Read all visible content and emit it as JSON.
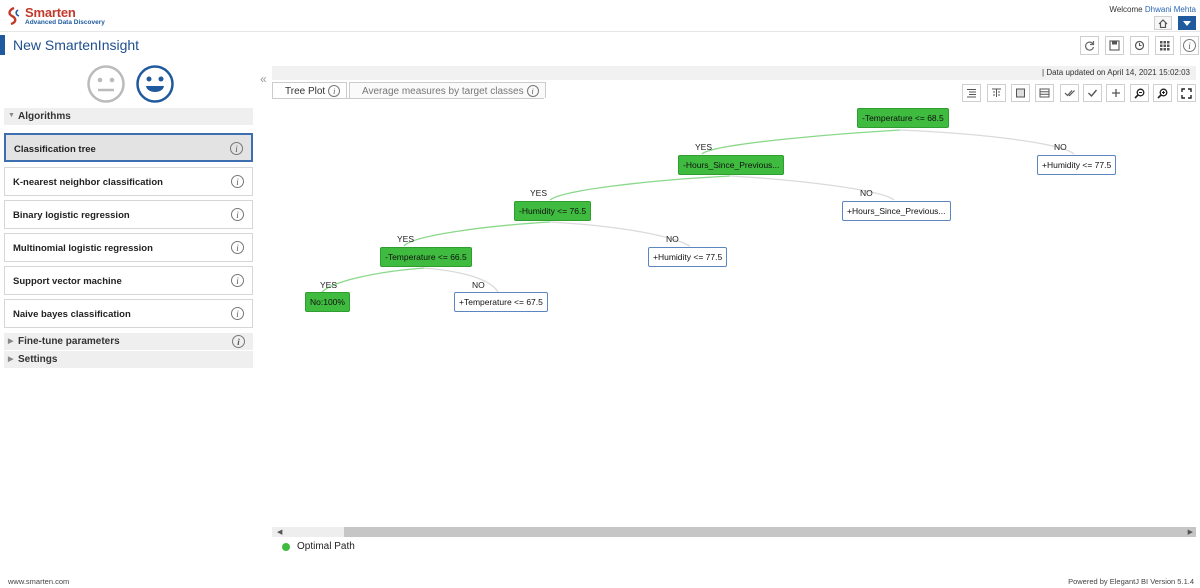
{
  "brand": {
    "logo_line1": "Smarten",
    "logo_line2": "Advanced Data Discovery"
  },
  "header": {
    "welcome": "Welcome",
    "user": "Dhwani Mehta"
  },
  "page_title": "New SmartenInsight",
  "algorithms_label": "Algorithms",
  "algorithms": [
    {
      "label": "Classification tree",
      "selected": true
    },
    {
      "label": "K-nearest neighbor classification",
      "selected": false
    },
    {
      "label": "Binary logistic regression",
      "selected": false
    },
    {
      "label": "Multinomial logistic regression",
      "selected": false
    },
    {
      "label": "Support vector machine",
      "selected": false
    },
    {
      "label": "Naive bayes classification",
      "selected": false
    }
  ],
  "fine_tune_label": "Fine-tune parameters",
  "settings_label": "Settings",
  "data_updated": "|  Data updated on April 14, 2021 15:02:03",
  "tabs": [
    {
      "label": "Tree Plot",
      "active": true
    },
    {
      "label": "Average measures by target classes",
      "active": false
    }
  ],
  "tree": {
    "n1": "-Temperature <= 68.5",
    "n2": "-Hours_Since_Previous...",
    "n3": "+Humidity <= 77.5",
    "n4": "-Humidity <= 76.5",
    "n5": "+Hours_Since_Previous...",
    "n6": "-Temperature <= 66.5",
    "n7": "+Humidity <= 77.5",
    "n8": "No:100%",
    "n9": "+Temperature <= 67.5",
    "yes": "YES",
    "no": "NO"
  },
  "legend": {
    "optimal_path": "Optimal Path"
  },
  "colors": {
    "optimal": "#3fbb3f",
    "brand_blue": "#1f5a9e"
  },
  "footer": {
    "left": "www.smarten.com",
    "right": "Powered by ElegantJ BI Version 5.1.4"
  }
}
